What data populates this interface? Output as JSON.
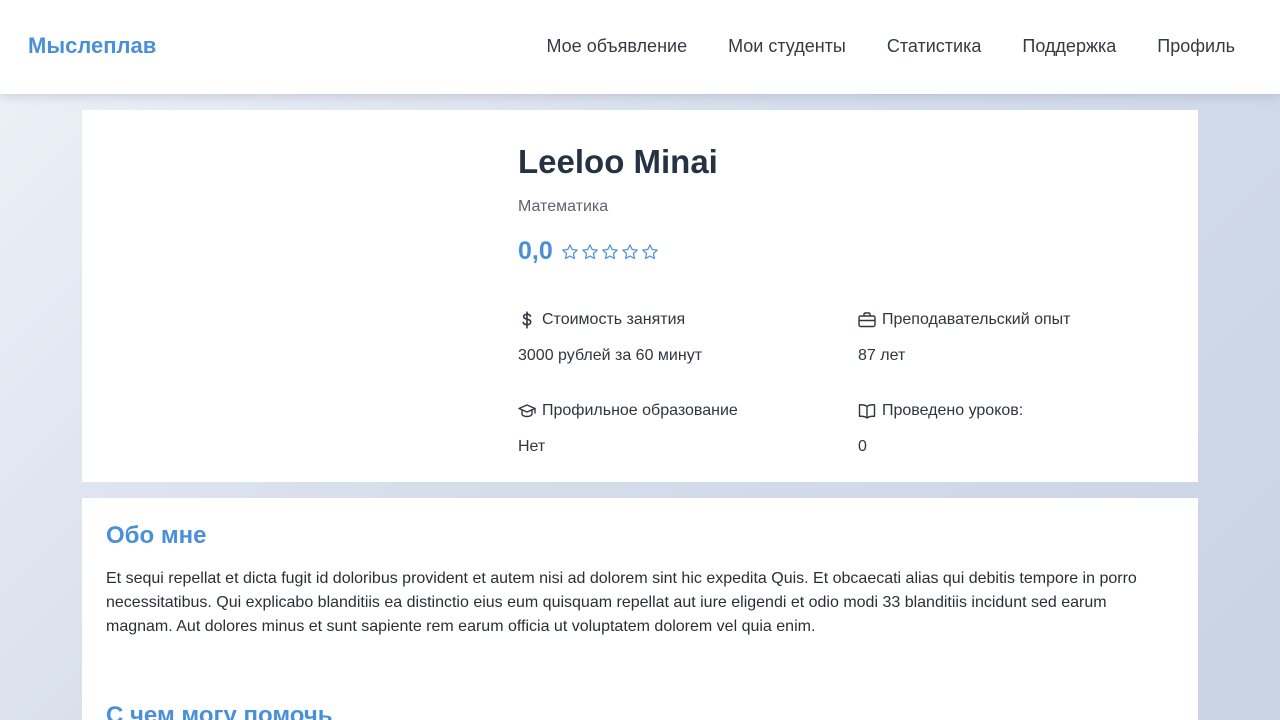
{
  "header": {
    "logo": "Мыслеплав",
    "nav": [
      {
        "label": "Мое объявление"
      },
      {
        "label": "Мои студенты"
      },
      {
        "label": "Статистика"
      },
      {
        "label": "Поддержка"
      },
      {
        "label": "Профиль"
      }
    ]
  },
  "profile": {
    "name": "Leeloo Minai",
    "subject": "Математика",
    "rating": "0,0",
    "stars_filled": 0,
    "stars_total": 5,
    "info": [
      {
        "label": "Стоимость занятия",
        "value": "3000 рублей за 60 минут",
        "icon": "dollar-icon"
      },
      {
        "label": "Преподавательский опыт",
        "value": "87 лет",
        "icon": "briefcase-icon"
      },
      {
        "label": "Профильное образование",
        "value": "Нет",
        "icon": "graduation-cap-icon"
      },
      {
        "label": "Проведено уроков:",
        "value": "0",
        "icon": "book-icon"
      }
    ]
  },
  "about": {
    "title": "Обо мне",
    "text": "Et sequi repellat et dicta fugit id doloribus provident et autem nisi ad dolorem sint hic expedita Quis. Et obcaecati alias qui debitis tempore in porro necessitatibus. Qui explicabo blanditiis ea distinctio eius eum quisquam repellat aut iure eligendi et odio modi 33 blanditiis incidunt sed earum magnam. Aut dolores minus et sunt sapiente rem earum officia ut voluptatem dolorem vel quia enim.",
    "help_title": "С чем могу помочь"
  },
  "colors": {
    "accent": "#4a90d9",
    "text": "#2c3440"
  }
}
